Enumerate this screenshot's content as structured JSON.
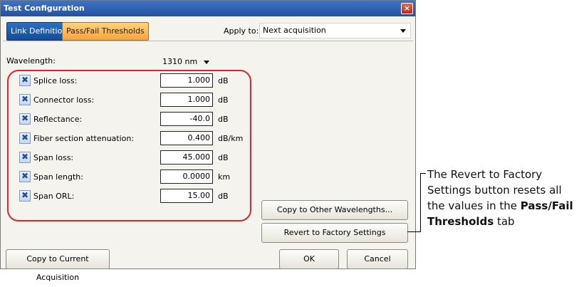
{
  "window": {
    "title": "Test Configuration",
    "close_icon": "×"
  },
  "tabs": [
    {
      "label": "Link Definition",
      "active": false
    },
    {
      "label": "Pass/Fail Thresholds",
      "active": true
    }
  ],
  "apply_to": {
    "label": "Apply to:",
    "value": "Next acquisition"
  },
  "wavelength": {
    "label": "Wavelength:",
    "value": "1310 nm"
  },
  "thresholds": [
    {
      "label": "Splice loss:",
      "value": "1.000",
      "unit": "dB",
      "checked": true
    },
    {
      "label": "Connector loss:",
      "value": "1.000",
      "unit": "dB",
      "checked": true
    },
    {
      "label": "Reflectance:",
      "value": "-40.0",
      "unit": "dB",
      "checked": true
    },
    {
      "label": "Fiber section attenuation:",
      "value": "0.400",
      "unit": "dB/km",
      "checked": true
    },
    {
      "label": "Span loss:",
      "value": "45.000",
      "unit": "dB",
      "checked": true
    },
    {
      "label": "Span length:",
      "value": "0.0000",
      "unit": "km",
      "checked": true
    },
    {
      "label": "Span ORL:",
      "value": "15.00",
      "unit": "dB",
      "checked": true
    }
  ],
  "check_glyph": "✖",
  "buttons": {
    "copy_wavelengths": "Copy to Other Wavelengths...",
    "revert": "Revert to Factory Settings",
    "copy_acquisition": "Copy to Current Acquisition",
    "ok": "OK",
    "cancel": "Cancel"
  },
  "callout": {
    "text_before": "The Revert to Factory Settings button resets all the values in the ",
    "bold": "Pass/Fail Thresholds",
    "text_after": " tab"
  },
  "colors": {
    "highlight": "#e0242c",
    "active_tab": "#f7a43a",
    "titlebar": "#2351a0"
  }
}
